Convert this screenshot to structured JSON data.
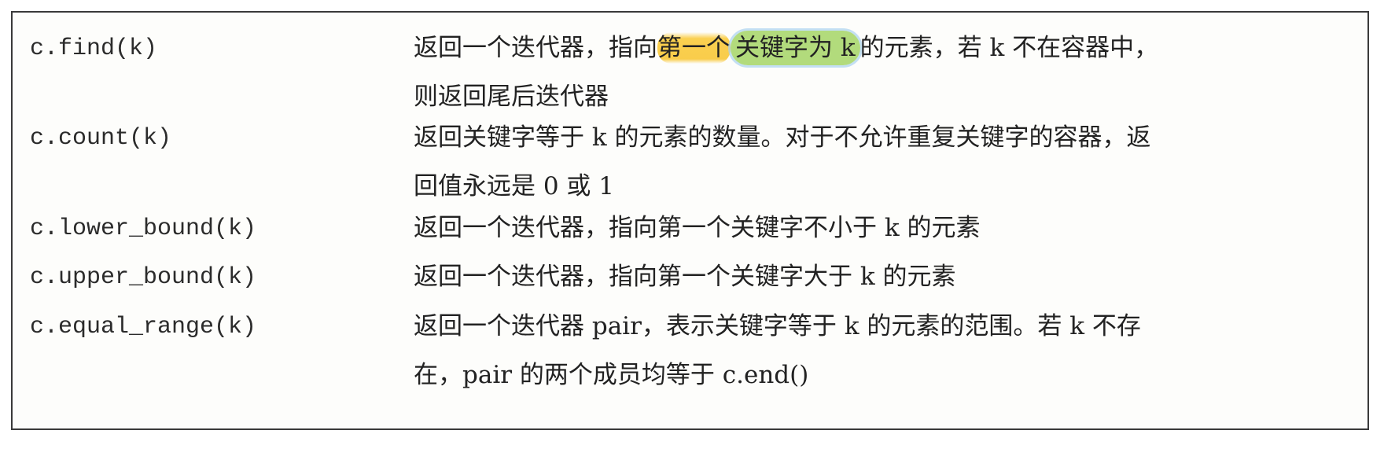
{
  "table": {
    "rows": [
      {
        "op": "c.find(k)",
        "desc_line1_pre": "返回一个迭代器，指向",
        "desc_line1_hl1": "第一个",
        "desc_line1_hl2": "关键字为 k",
        "desc_line1_post": "的元素，若 k 不在容器中，",
        "desc_line2": "则返回尾后迭代器"
      },
      {
        "op": "c.count(k)",
        "desc_line1": "返回关键字等于 k 的元素的数量。对于不允许重复关键字的容器，返",
        "desc_line2": "回值永远是 0 或 1"
      },
      {
        "op": "c.lower_bound(k)",
        "desc_line1": "返回一个迭代器，指向第一个关键字不小于 k 的元素"
      },
      {
        "op": "c.upper_bound(k)",
        "desc_line1": "返回一个迭代器，指向第一个关键字大于 k 的元素"
      },
      {
        "op": "c.equal_range(k)",
        "desc_line1": "返回一个迭代器 pair，表示关键字等于 k 的元素的范围。若 k 不存",
        "desc_line2": "在，pair 的两个成员均等于 c.end()"
      }
    ]
  },
  "highlight_colors": {
    "yellow": "#f8c42c",
    "green": "#aad76e"
  }
}
